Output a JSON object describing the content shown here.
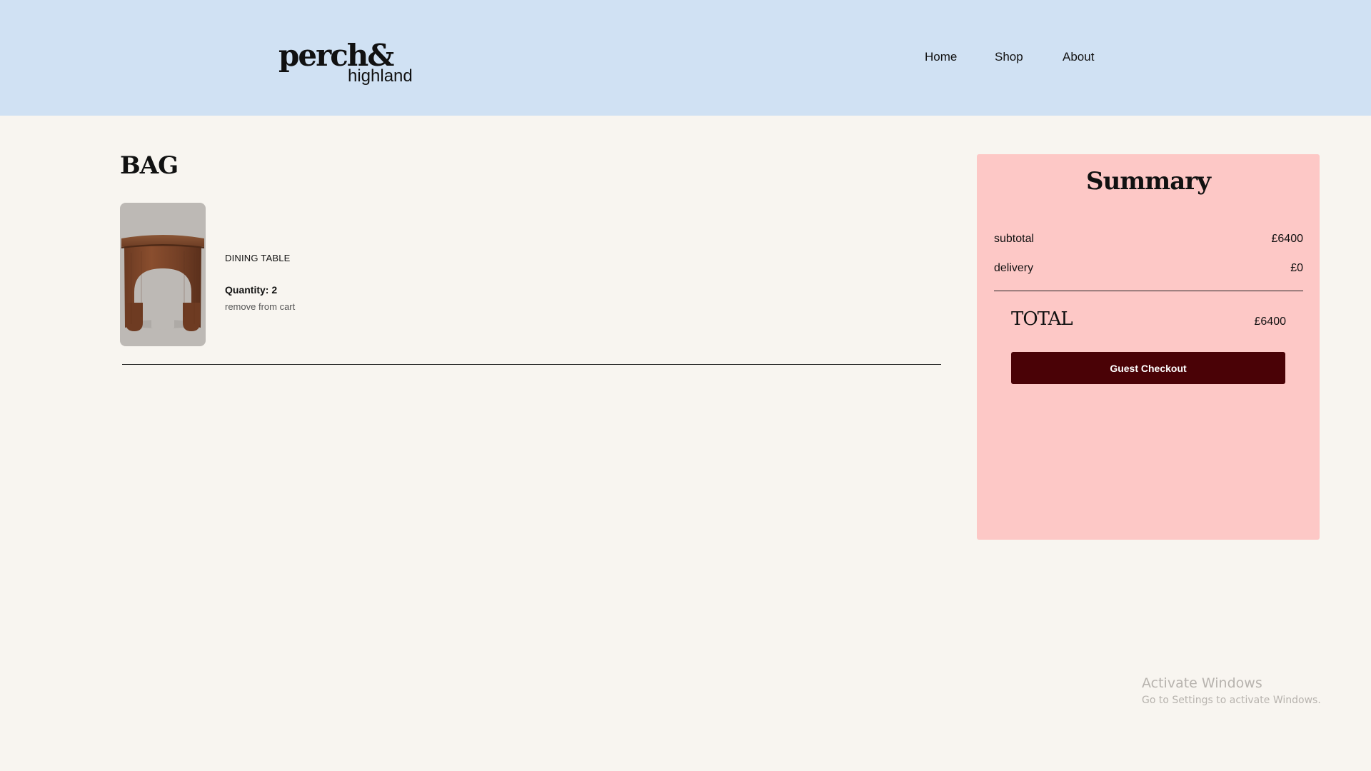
{
  "header": {
    "logo_main": "perch&",
    "logo_sub": "highland",
    "nav": {
      "home": "Home",
      "shop": "Shop",
      "about": "About"
    },
    "background_color": "#d0e1f3"
  },
  "bag": {
    "title": "BAG",
    "items": [
      {
        "image_icon": "wooden-stool-icon",
        "name": "DINING TABLE",
        "quantity_label": "Quantity: 2",
        "remove_label": "remove from cart"
      }
    ]
  },
  "summary": {
    "title": "Summary",
    "subtotal_label": "subtotal",
    "subtotal_value": "£6400",
    "delivery_label": "delivery",
    "delivery_value": "£0",
    "total_label": "TOTAL",
    "total_value": "£6400",
    "checkout_label": "Guest Checkout",
    "background_color": "#fdc8c6",
    "button_color": "#4a0206"
  },
  "watermark": {
    "title": "Activate Windows",
    "subtitle": "Go to Settings to activate Windows."
  }
}
